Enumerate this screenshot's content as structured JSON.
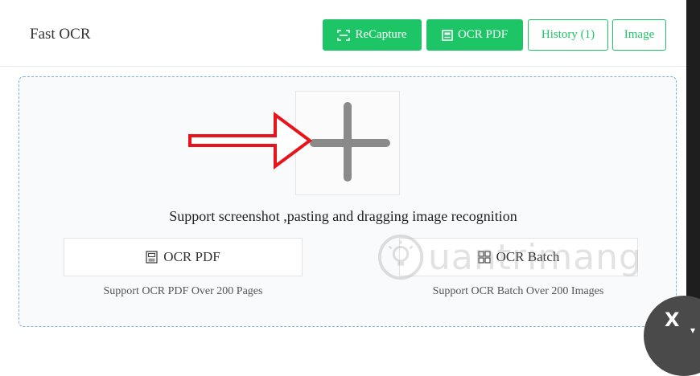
{
  "app": {
    "title": "Fast OCR"
  },
  "toolbar": {
    "recapture_label": "ReCapture",
    "ocr_pdf_label": "OCR PDF",
    "history_label": "History (1)",
    "image_label": "Image"
  },
  "dropzone": {
    "support_text": "Support screenshot ,pasting and dragging image recognition",
    "plus_icon": "plus-icon",
    "annotation_arrow_color": "#e8141c"
  },
  "options": [
    {
      "label": "OCR PDF",
      "icon": "document-icon",
      "caption": "Support OCR PDF Over 200 Pages"
    },
    {
      "label": "OCR Batch",
      "icon": "grid-icon",
      "caption": "Support OCR Batch Over 200 Images"
    }
  ],
  "watermark": {
    "text": "uantrimang"
  },
  "close": {
    "label": "X"
  },
  "colors": {
    "accent": "#1ec567",
    "dropzone_border": "#7fb1e0"
  }
}
